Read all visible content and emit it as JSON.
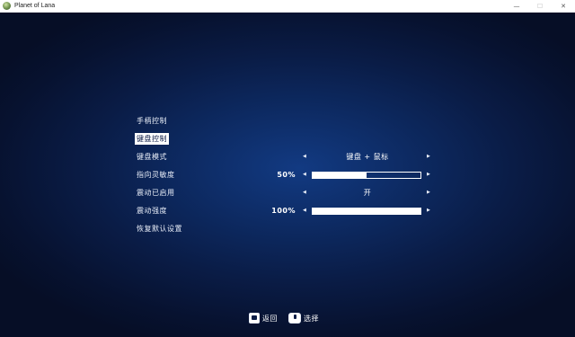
{
  "window": {
    "title": "Planet of Lana",
    "minimize_glyph": "—",
    "maximize_glyph": "☐",
    "close_glyph": "✕"
  },
  "menu": {
    "gamepad_controls": "手柄控制",
    "keyboard_controls": "键盘控制",
    "restore_defaults": "恢复默认设置"
  },
  "settings": [
    {
      "label": "键盘模式",
      "type": "select",
      "value": "键盘 + 鼠标"
    },
    {
      "label": "指向灵敏度",
      "type": "slider",
      "percent_text": "50%",
      "level": 0.5
    },
    {
      "label": "震动已启用",
      "type": "select",
      "value": "开"
    },
    {
      "label": "震动强度",
      "type": "slider",
      "percent_text": "100%",
      "level": 1.0
    }
  ],
  "arrows": {
    "left": "◀",
    "right": "▶"
  },
  "footer": {
    "back_label": "返回",
    "select_label": "选择"
  },
  "colors": {
    "background": "#0a1638",
    "accent_center": "#123a82",
    "text": "#e9eef8",
    "highlight": "#ffffff"
  }
}
